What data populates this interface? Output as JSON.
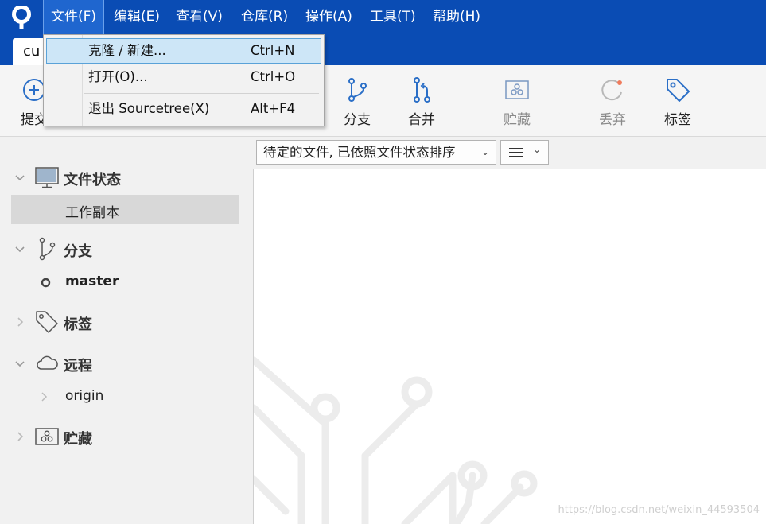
{
  "menubar": {
    "items": [
      "文件(F)",
      "编辑(E)",
      "查看(V)",
      "仓库(R)",
      "操作(A)",
      "工具(T)",
      "帮助(H)"
    ]
  },
  "tab": {
    "title": "cu"
  },
  "toolbar": {
    "commit": "提交",
    "branch": "分支",
    "merge": "合并",
    "stash": "贮藏",
    "discard": "丢弃",
    "tag": "标签"
  },
  "file_menu": {
    "items": [
      {
        "label": "克隆 / 新建...",
        "shortcut": "Ctrl+N"
      },
      {
        "label": "打开(O)...",
        "shortcut": "Ctrl+O"
      },
      {
        "label": "退出 Sourcetree(X)",
        "shortcut": "Alt+F4"
      }
    ]
  },
  "sidebar": {
    "file_status": "文件状态",
    "working_copy": "工作副本",
    "branches": "分支",
    "current_branch": "master",
    "tags": "标签",
    "remotes": "远程",
    "remote_origin": "origin",
    "stashes": "贮藏"
  },
  "main": {
    "filter": "待定的文件, 已依照文件状态排序",
    "watermark": "https://blog.csdn.net/weixin_44593504"
  },
  "colors": {
    "menubar_bg": "#0a4cb4",
    "accent_blue": "#2b6fc7",
    "highlight": "#cde6f7"
  }
}
